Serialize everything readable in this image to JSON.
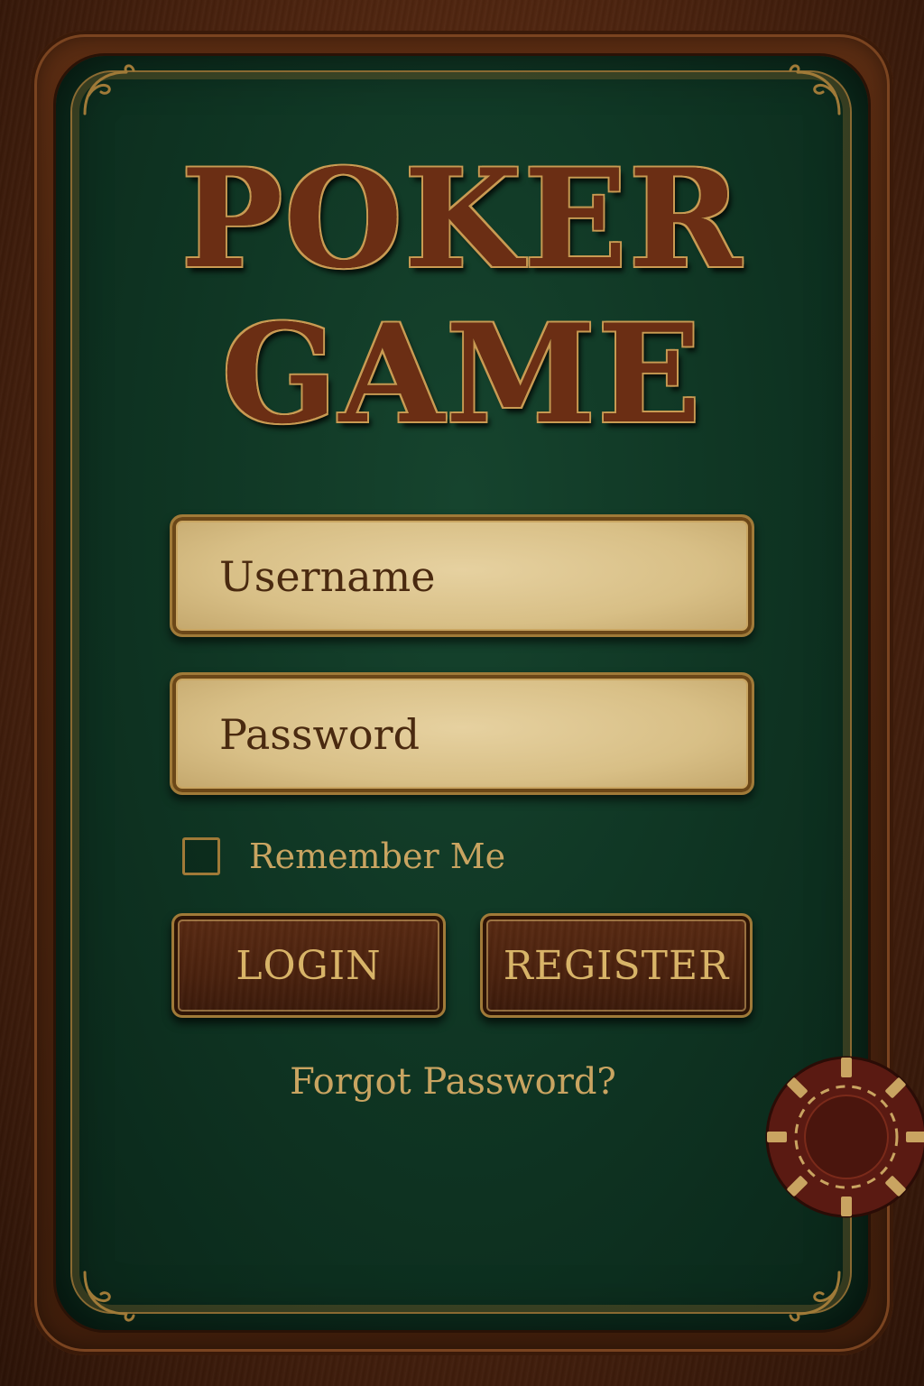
{
  "title": {
    "line1": "POKER",
    "line2": "GAME"
  },
  "login_form": {
    "username_placeholder": "Username",
    "password_placeholder": "Password",
    "remember_label": "Remember Me",
    "remember_checked": false,
    "login_label": "LOGIN",
    "register_label": "REGISTER",
    "forgot_label": "Forgot Password?"
  },
  "icons": {
    "corner": "ornamental-flourish",
    "chip": "poker-chip-icon"
  },
  "colors": {
    "felt": "#0f3523",
    "wood": "#4a220e",
    "gold": "#c9a461",
    "parchment": "#d8bf86"
  }
}
